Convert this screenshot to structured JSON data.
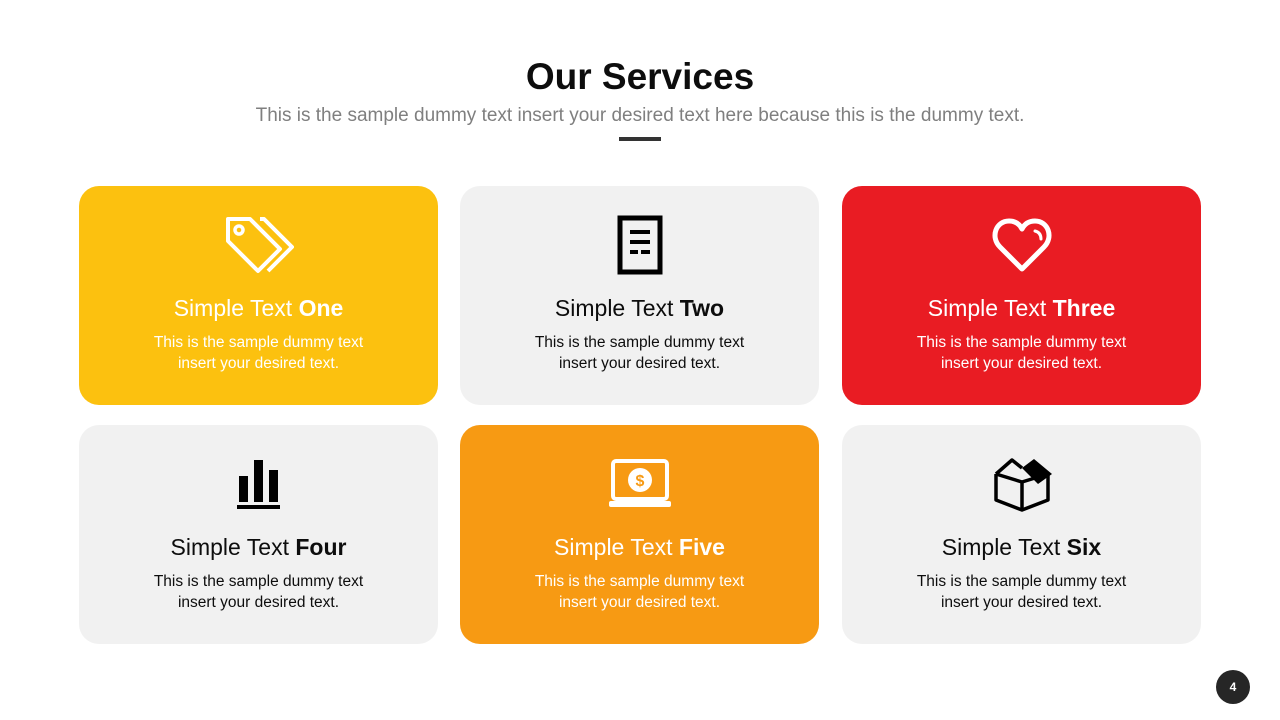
{
  "header": {
    "title": "Our Services",
    "subtitle": "This is the sample dummy text insert your desired text here because this is the dummy text."
  },
  "cards": [
    {
      "heading_plain": "Simple Text ",
      "heading_bold": "One",
      "desc_line1": "This is the sample dummy text",
      "desc_line2": "insert your desired text.",
      "icon": "price-tags-icon",
      "color": "#fcc10f"
    },
    {
      "heading_plain": "Simple Text ",
      "heading_bold": "Two",
      "desc_line1": "This is the sample dummy text",
      "desc_line2": "insert your desired text.",
      "icon": "document-icon",
      "color": "#f1f1f1"
    },
    {
      "heading_plain": "Simple Text ",
      "heading_bold": "Three",
      "desc_line1": "This is the sample dummy text",
      "desc_line2": "insert your desired text.",
      "icon": "heart-icon",
      "color": "#e91c23"
    },
    {
      "heading_plain": "Simple Text ",
      "heading_bold": "Four",
      "desc_line1": "This is the sample dummy text",
      "desc_line2": "insert your desired text.",
      "icon": "bar-chart-icon",
      "color": "#f1f1f1"
    },
    {
      "heading_plain": "Simple Text ",
      "heading_bold": "Five",
      "desc_line1": "This is the sample dummy text",
      "desc_line2": "insert your desired text.",
      "icon": "laptop-dollar-icon",
      "color": "#f79a13"
    },
    {
      "heading_plain": "Simple Text ",
      "heading_bold": "Six",
      "desc_line1": "This is the sample dummy text",
      "desc_line2": "insert your desired text.",
      "icon": "open-box-icon",
      "color": "#f1f1f1"
    }
  ],
  "footer": {
    "page_number": "4"
  }
}
